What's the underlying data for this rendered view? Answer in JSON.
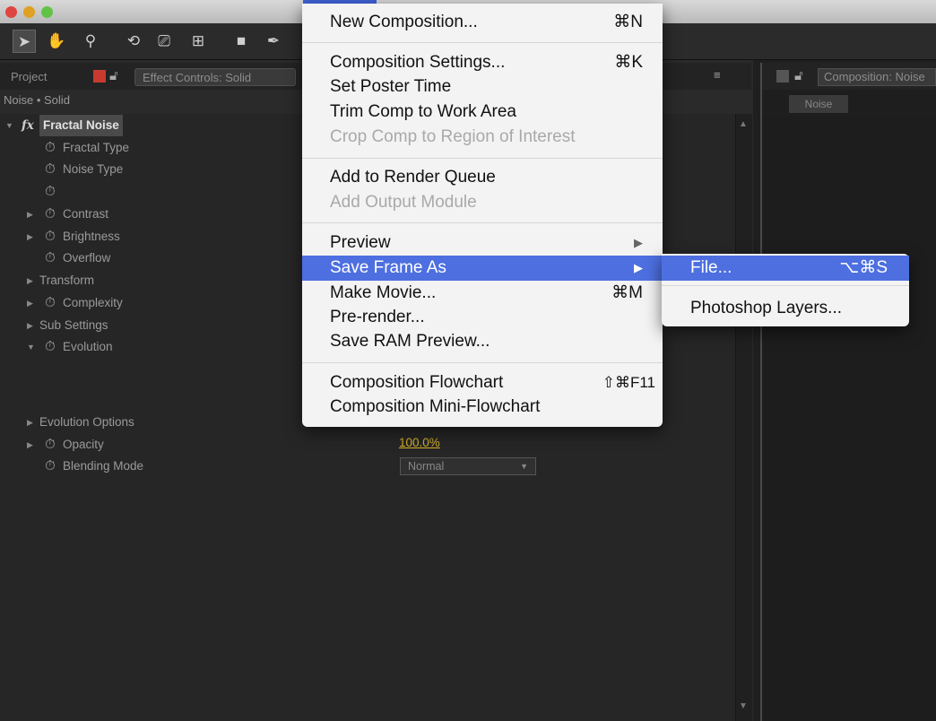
{
  "colors": {
    "highlight": "#4d6fe0",
    "menu_bg": "#f3f3f3",
    "value_accent": "#d4b02a"
  },
  "left_panel": {
    "tab_project": "Project",
    "tab_effect_controls": "Effect Controls: Solid",
    "breadcrumb": "Noise • Solid",
    "effect_name": "Fractal Noise",
    "rows": [
      "Fractal Type",
      "Noise Type",
      "",
      "Contrast",
      "Brightness",
      "Overflow",
      "Transform",
      "Complexity",
      "Sub Settings",
      "Evolution",
      "Evolution Options",
      "Opacity",
      "Blending Mode"
    ],
    "opacity_value": "100.0%",
    "blending_mode_value": "Normal"
  },
  "right_panel": {
    "tab_label": "Composition: Noise",
    "comp_tab": "Noise"
  },
  "menu": {
    "items": [
      {
        "label": "New Composition...",
        "shortcut": "⌘N"
      },
      {
        "label": "Composition Settings...",
        "shortcut": "⌘K"
      },
      {
        "label": "Set Poster Time",
        "shortcut": ""
      },
      {
        "label": "Trim Comp to Work Area",
        "shortcut": ""
      },
      {
        "label": "Crop Comp to Region of Interest",
        "shortcut": ""
      },
      {
        "label": "Add to Render Queue",
        "shortcut": ""
      },
      {
        "label": "Add Output Module",
        "shortcut": ""
      },
      {
        "label": "Preview",
        "shortcut": "▶"
      },
      {
        "label": "Save Frame As",
        "shortcut": "▶"
      },
      {
        "label": "Make Movie...",
        "shortcut": "⌘M"
      },
      {
        "label": "Pre-render...",
        "shortcut": ""
      },
      {
        "label": "Save RAM Preview...",
        "shortcut": ""
      },
      {
        "label": "Composition Flowchart",
        "shortcut": "⇧⌘F11"
      },
      {
        "label": "Composition Mini-Flowchart",
        "shortcut": ""
      }
    ],
    "submenu": [
      {
        "label": "File...",
        "shortcut": "⌥⌘S"
      },
      {
        "label": "Photoshop Layers...",
        "shortcut": ""
      }
    ]
  }
}
